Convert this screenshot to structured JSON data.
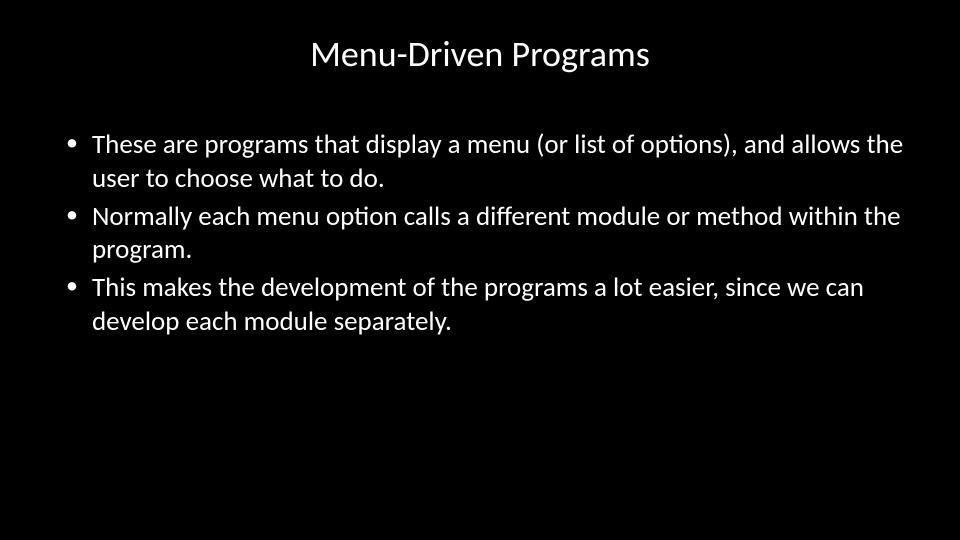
{
  "slide": {
    "title": "Menu-Driven Programs",
    "bullets": [
      "These are programs that display a menu (or list of options), and allows the user to choose what to do.",
      "Normally each menu option calls a different module or method within the program.",
      "This makes the development of the programs a lot easier, since we can develop each module separately."
    ]
  }
}
